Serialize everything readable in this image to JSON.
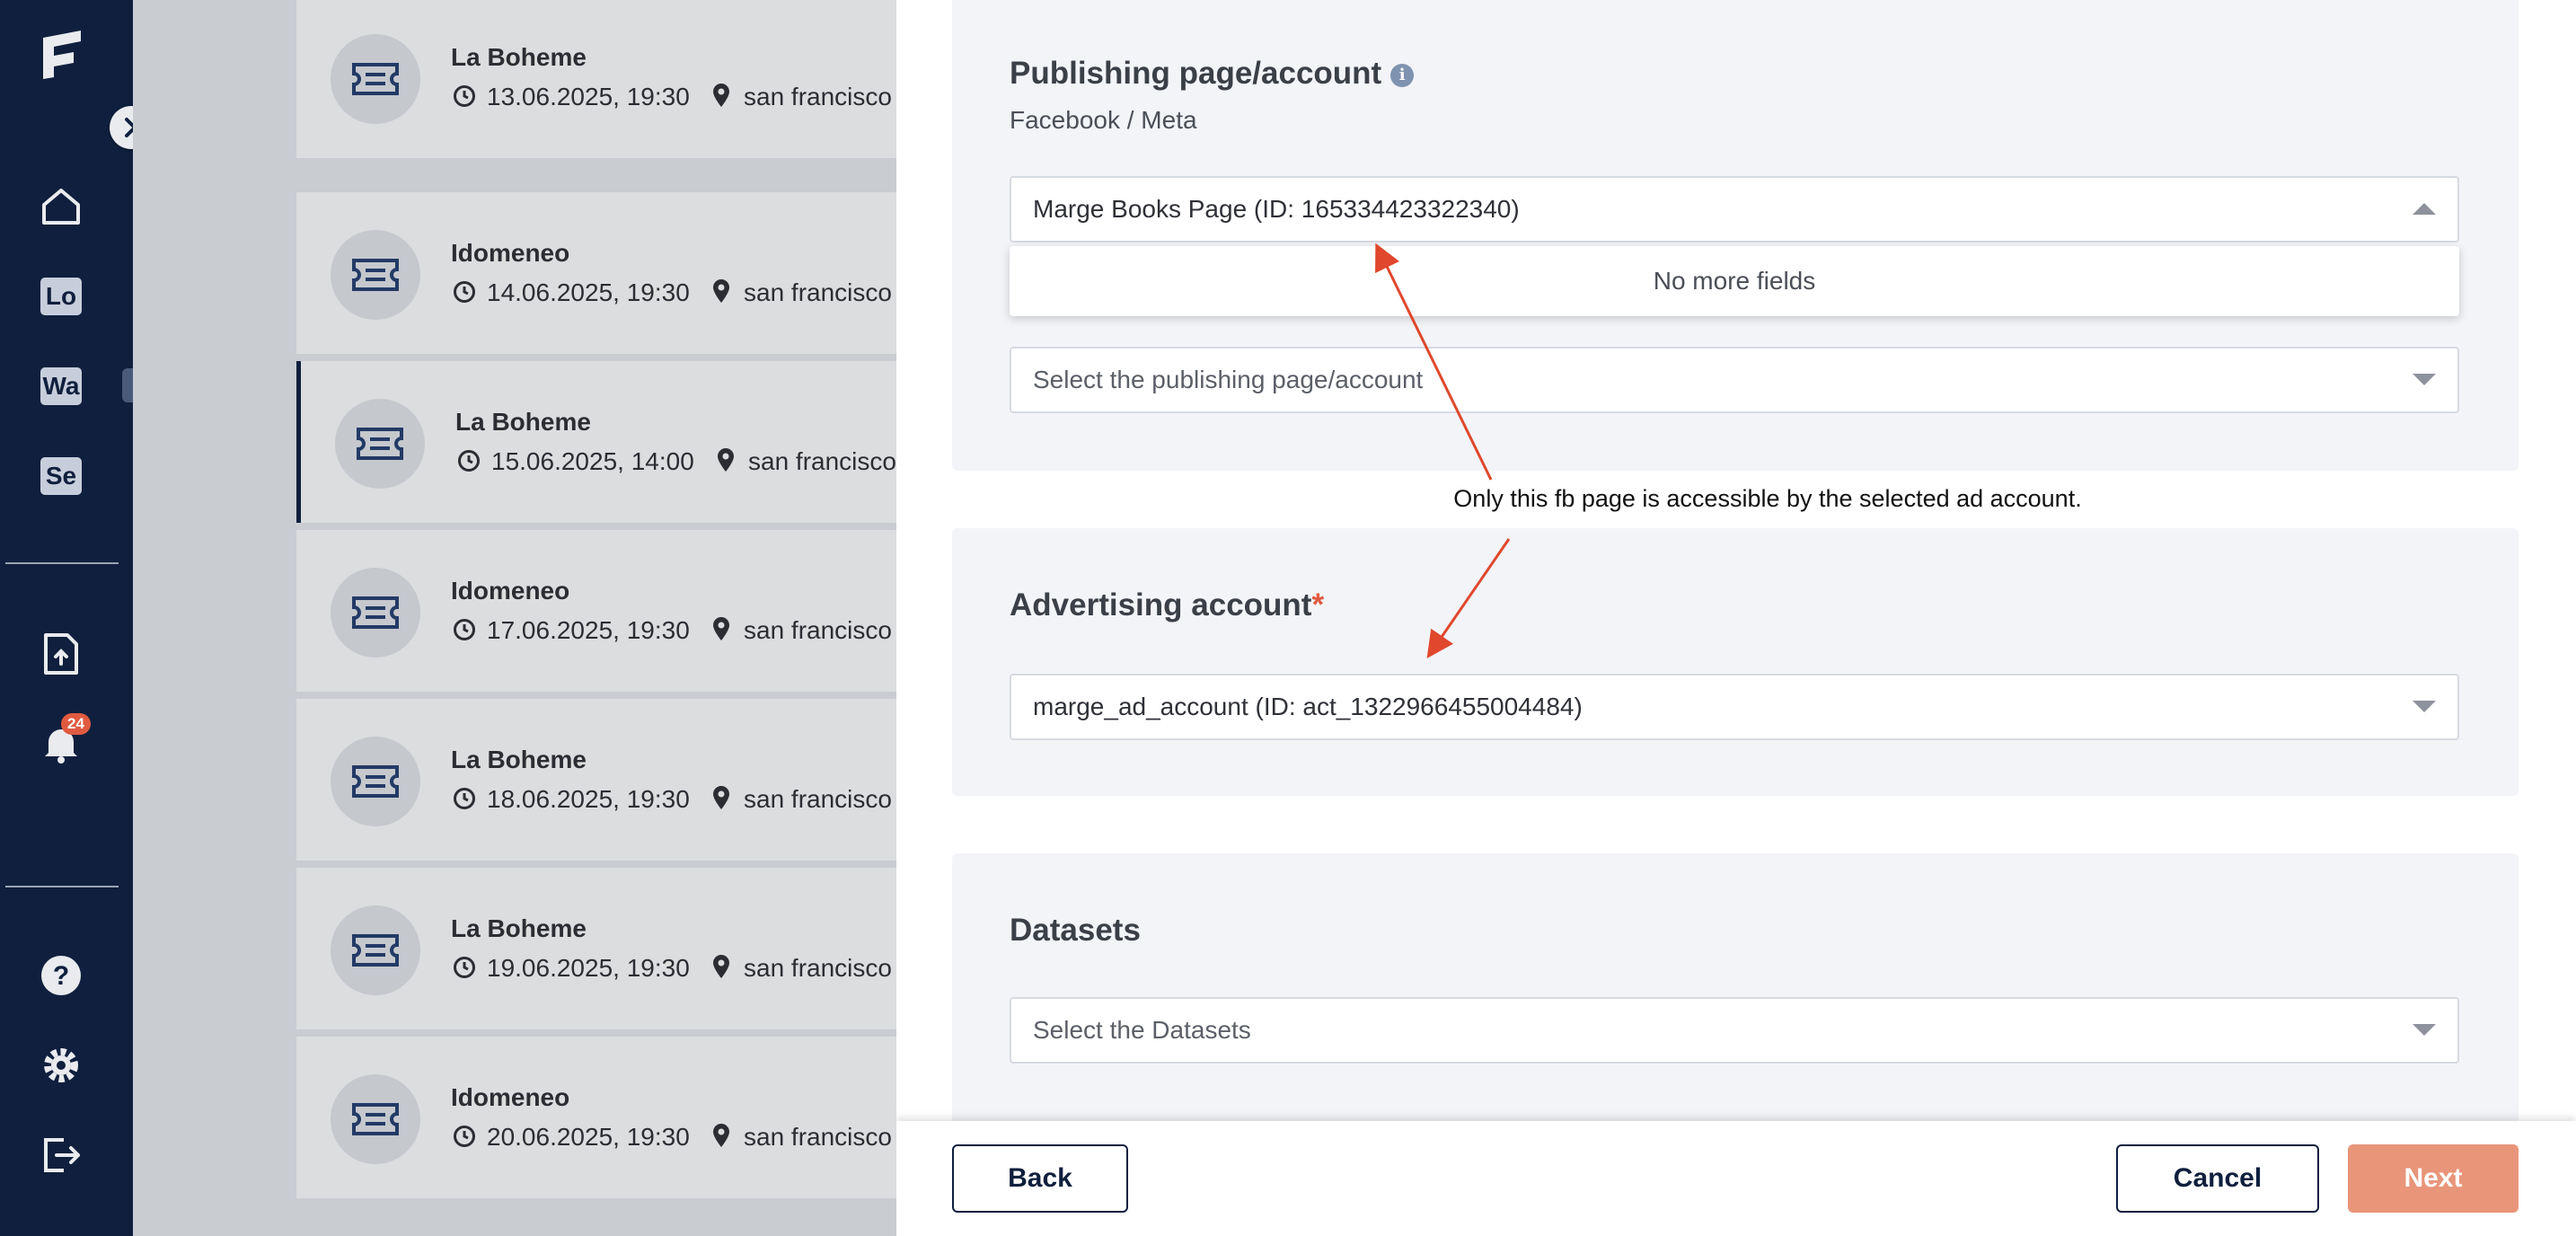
{
  "nav": {
    "items": [
      {
        "icon": "home-icon"
      },
      {
        "label": "Lo"
      },
      {
        "label": "Wa"
      },
      {
        "label": "Se"
      },
      {
        "icon": "file-upload-icon"
      },
      {
        "icon": "bell-icon",
        "badge": "24"
      },
      {
        "icon": "help-icon"
      },
      {
        "icon": "gear-icon"
      },
      {
        "icon": "logout-icon"
      }
    ]
  },
  "events": [
    {
      "name": "La Boheme",
      "date": "13.06.2025, 19:30",
      "location": "san francisco"
    },
    {
      "name": "Idomeneo",
      "date": "14.06.2025, 19:30",
      "location": "san francisco"
    },
    {
      "name": "La Boheme",
      "date": "15.06.2025, 14:00",
      "location": "san francisco"
    },
    {
      "name": "Idomeneo",
      "date": "17.06.2025, 19:30",
      "location": "san francisco"
    },
    {
      "name": "La Boheme",
      "date": "18.06.2025, 19:30",
      "location": "san francisco"
    },
    {
      "name": "La Boheme",
      "date": "19.06.2025, 19:30",
      "location": "san francisco"
    },
    {
      "name": "Idomeneo",
      "date": "20.06.2025, 19:30",
      "location": "san francisco"
    }
  ],
  "publishing": {
    "title": "Publishing page/account",
    "platform": "Facebook / Meta",
    "selected": "Marge Books Page (ID: 165334423322340)",
    "dropdown_empty": "No more fields",
    "second_placeholder": "Select the publishing page/account"
  },
  "annotation": "Only this fb page is accessible by the selected ad account.",
  "advertising": {
    "title": "Advertising account",
    "required_mark": "*",
    "selected": "marge_ad_account (ID: act_1322966455004484)"
  },
  "datasets": {
    "title": "Datasets",
    "placeholder": "Select the Datasets"
  },
  "footer": {
    "back": "Back",
    "cancel": "Cancel",
    "next": "Next"
  },
  "colors": {
    "nav_bg": "#0f1f3d",
    "accent": "#e8957a",
    "annotation_arrow": "#e0472c"
  }
}
